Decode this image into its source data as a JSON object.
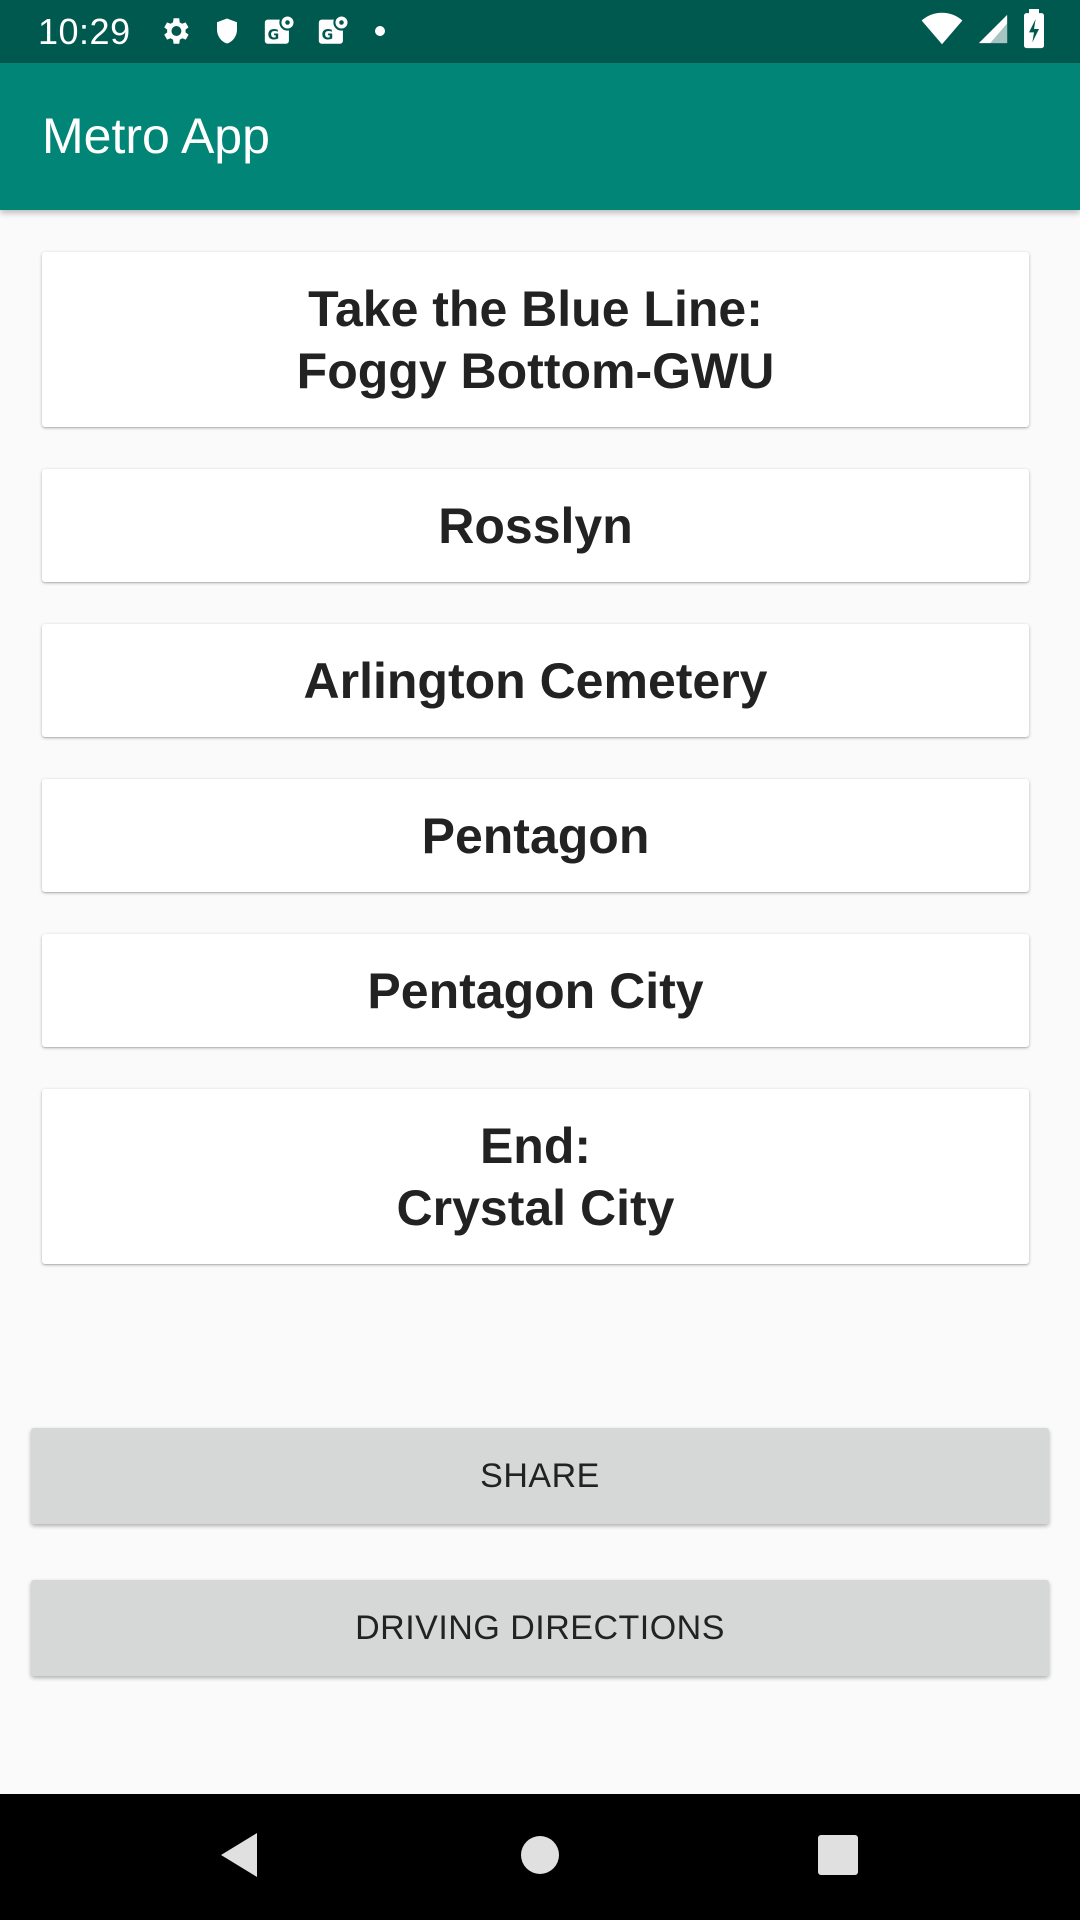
{
  "status_bar": {
    "time": "10:29",
    "left_icons": [
      "settings-icon",
      "shield-icon",
      "maps-icon",
      "maps-icon",
      "dot-icon"
    ],
    "right_icons": [
      "wifi-icon",
      "cell-signal-icon",
      "battery-icon"
    ]
  },
  "app_bar": {
    "title": "Metro App",
    "color": "#008577"
  },
  "stations": [
    {
      "line1": "Take the Blue Line:",
      "line2": "Foggy Bottom-GWU"
    },
    {
      "line1": "Rosslyn",
      "line2": ""
    },
    {
      "line1": "Arlington Cemetery",
      "line2": ""
    },
    {
      "line1": "Pentagon",
      "line2": ""
    },
    {
      "line1": "Pentagon City",
      "line2": ""
    },
    {
      "line1": "End:",
      "line2": "Crystal City"
    }
  ],
  "actions": {
    "share_label": "SHARE",
    "driving_directions_label": "DRIVING DIRECTIONS"
  },
  "nav_bar": {
    "icons": [
      "back-icon",
      "home-icon",
      "recents-icon"
    ]
  }
}
